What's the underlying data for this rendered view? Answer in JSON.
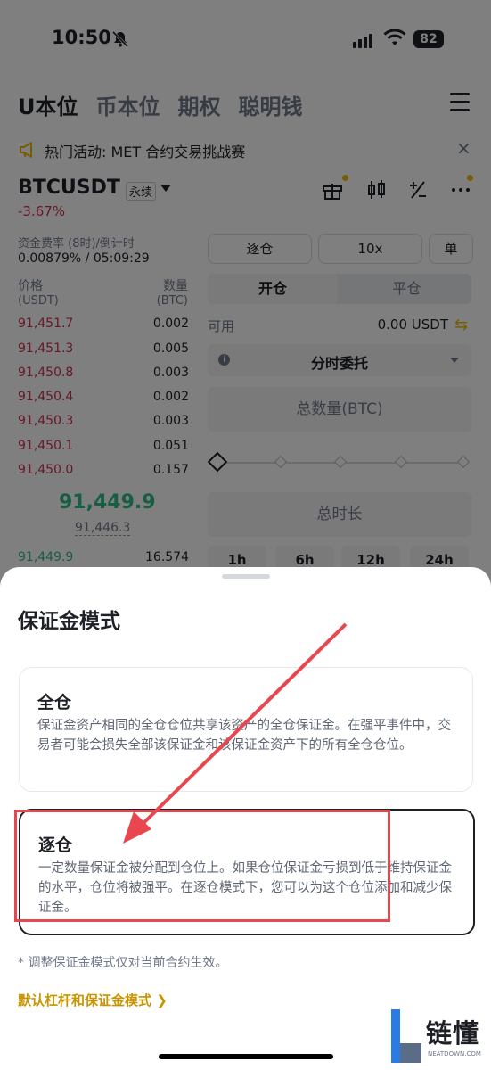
{
  "status_bar": {
    "time": "10:50",
    "battery": "82"
  },
  "top_tabs": [
    {
      "label": "U本位",
      "active": true
    },
    {
      "label": "币本位",
      "active": false
    },
    {
      "label": "期权",
      "active": false
    },
    {
      "label": "聪明钱",
      "active": false
    }
  ],
  "announcement": {
    "text": "热门活动: MET 合约交易挑战赛",
    "close": "×"
  },
  "instrument": {
    "symbol": "BTCUSDT",
    "type": "永续",
    "change": "-3.67%"
  },
  "funding": {
    "label": "资金费率 (8时)/倒计时",
    "value": "0.00879% / 05:09:29"
  },
  "order_book": {
    "price_header": "价格",
    "price_unit": "(USDT)",
    "qty_header": "数量",
    "qty_unit": "(BTC)",
    "asks": [
      {
        "price": "91,451.7",
        "qty": "0.002"
      },
      {
        "price": "91,451.3",
        "qty": "0.005"
      },
      {
        "price": "91,450.8",
        "qty": "0.003"
      },
      {
        "price": "91,450.4",
        "qty": "0.002"
      },
      {
        "price": "91,450.3",
        "qty": "0.003"
      },
      {
        "price": "91,450.1",
        "qty": "0.051"
      },
      {
        "price": "91,450.0",
        "qty": "0.157"
      }
    ],
    "last_price": "91,449.9",
    "mark_price": "91,446.3",
    "bids": [
      {
        "price": "91,449.9",
        "qty": "16.574"
      }
    ]
  },
  "order_form": {
    "margin_mode": "逐仓",
    "leverage": "10x",
    "position_mode": "单",
    "open_tab": "开仓",
    "close_tab": "平仓",
    "available_label": "可用",
    "available_value": "0.00 USDT",
    "order_type": "分时委托",
    "total_qty_placeholder": "总数量(BTC)",
    "duration_placeholder": "总时长",
    "durations": [
      "1h",
      "6h",
      "12h",
      "24h"
    ]
  },
  "sheet": {
    "title": "保证金模式",
    "options": [
      {
        "title": "全仓",
        "desc": "保证金资产相同的全仓仓位共享该资产的全仓保证金。在强平事件中，交易者可能会损失全部该保证金和该保证金资产下的所有全仓仓位。",
        "selected": false
      },
      {
        "title": "逐仓",
        "desc": "一定数量保证金被分配到仓位上。如果仓位保证金亏损到低于维持保证金的水平，仓位将被强平。在逐仓模式下，您可以为这个仓位添加和减少保证金。",
        "selected": true
      }
    ],
    "note": "* 调整保证金模式仅对当前合约生效。",
    "link": "默认杠杆和保证金模式 ❯"
  },
  "watermark": {
    "text": "链懂",
    "sub": "NEATDOWN.COM"
  },
  "colors": {
    "red": "#cf304a",
    "green": "#2ebd85",
    "accent": "#f0b90b",
    "annotation": "#e8474f"
  }
}
